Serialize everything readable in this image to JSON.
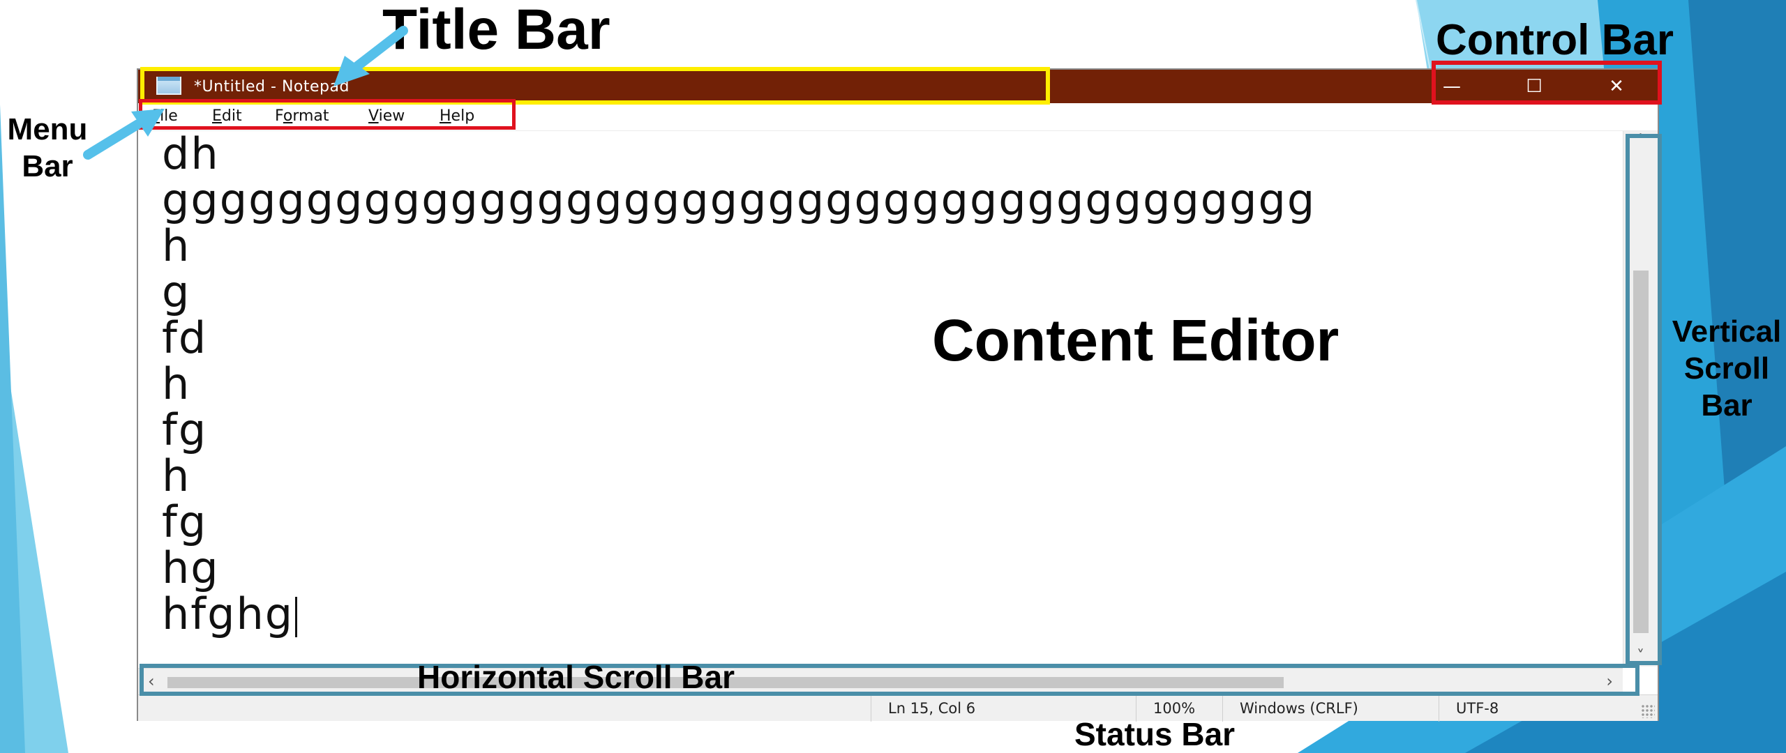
{
  "window": {
    "title": "*Untitled - Notepad",
    "controls": {
      "minimize": "—",
      "maximize": "☐",
      "close": "✕"
    }
  },
  "menu": [
    {
      "label": "File",
      "mnemonic": "F",
      "rest": "ile"
    },
    {
      "label": "Edit",
      "mnemonic": "E",
      "rest": "dit"
    },
    {
      "label": "Format",
      "mnemonic": "o",
      "pre": "F",
      "rest": "rmat"
    },
    {
      "label": "View",
      "mnemonic": "V",
      "rest": "iew"
    },
    {
      "label": "Help",
      "mnemonic": "H",
      "rest": "elp"
    }
  ],
  "editor": {
    "lines": [
      "dh",
      "gggggggggggggggggggggggggggggggggggggggg",
      "h",
      "g",
      "fd",
      "h",
      "fg",
      "h",
      "fg",
      "hg",
      "hfghg"
    ]
  },
  "status": {
    "position": "Ln 15, Col 6",
    "zoom": "100%",
    "line_ending": "Windows (CRLF)",
    "encoding": "UTF-8"
  },
  "annotations": {
    "title_bar": "Title Bar",
    "control_bar": "Control Bar",
    "menu_bar_line1": "Menu",
    "menu_bar_line2": "Bar",
    "content_editor": "Content Editor",
    "vertical_line1": "Vertical",
    "vertical_line2": "Scroll",
    "vertical_line3": "Bar",
    "horizontal_scroll_bar": "Horizontal Scroll Bar",
    "status_bar": "Status Bar"
  },
  "colors": {
    "titlebar": "#722106",
    "highlight_yellow": "#ffee00",
    "highlight_red": "#e0121e",
    "highlight_teal": "#4a8ea8",
    "arrow": "#55c0ea"
  }
}
